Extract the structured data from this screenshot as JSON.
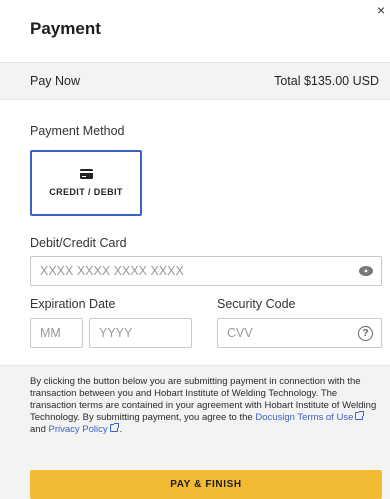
{
  "header": {
    "title": "Payment",
    "close_label": "×"
  },
  "summary": {
    "pay_label": "Pay Now",
    "total_label": "Total $135.00 USD"
  },
  "payment_method": {
    "label": "Payment Method",
    "option": {
      "label": "CREDIT / DEBIT",
      "icon": "credit-card-icon",
      "selected": true
    }
  },
  "card": {
    "label": "Debit/Credit Card",
    "placeholder": "XXXX XXXX XXXX XXXX",
    "value": ""
  },
  "expiration": {
    "label": "Expiration Date",
    "month_placeholder": "MM",
    "year_placeholder": "YYYY"
  },
  "security": {
    "label": "Security Code",
    "placeholder": "CVV",
    "help_glyph": "?"
  },
  "disclaimer": {
    "text_1": "By clicking the button below you are submitting payment in connection with the transaction between you and Hobart Institute of Welding Technology. The transaction terms are contained in your agreement with Hobart Institute of Welding Technology. By submitting payment, you agree to the ",
    "terms_link": "Docusign Terms of Use",
    "and": " and ",
    "privacy_link": "Privacy Policy",
    "end": "."
  },
  "actions": {
    "pay_label": "PAY & FINISH"
  },
  "colors": {
    "accent": "#3a63c5",
    "button": "#f2bb33",
    "panel": "#f3f3f3"
  }
}
